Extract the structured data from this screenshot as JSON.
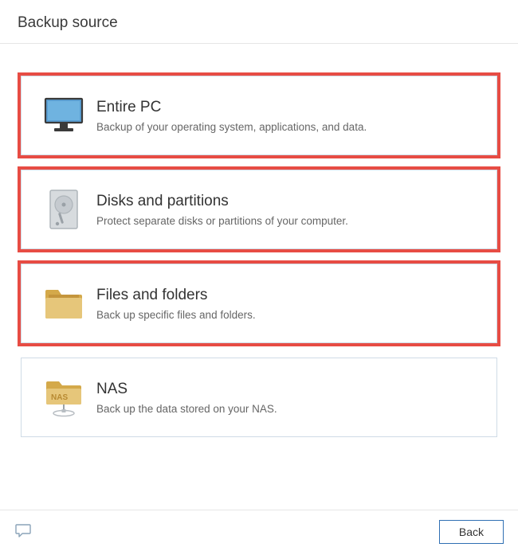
{
  "header": {
    "title": "Backup source"
  },
  "options": {
    "entire_pc": {
      "title": "Entire PC",
      "desc": "Backup of your operating system, applications, and data."
    },
    "disks": {
      "title": "Disks and partitions",
      "desc": "Protect separate disks or partitions of your computer."
    },
    "files": {
      "title": "Files and folders",
      "desc": "Back up specific files and folders."
    },
    "nas": {
      "title": "NAS",
      "desc": "Back up the data stored on your NAS."
    }
  },
  "footer": {
    "back_label": "Back"
  }
}
